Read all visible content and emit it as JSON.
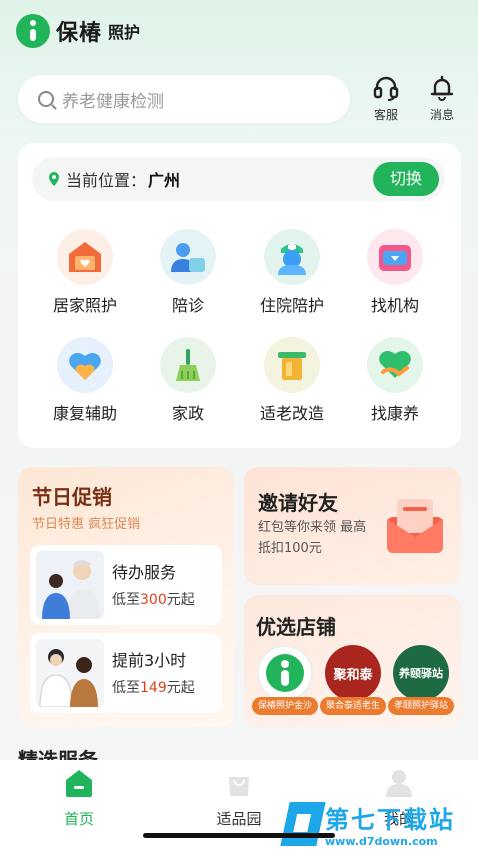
{
  "app": {
    "brand": "保椿",
    "brand_sub": "照护"
  },
  "search": {
    "placeholder": "养老健康检测"
  },
  "header_buttons": [
    {
      "label": "客服",
      "icon": "headset-icon"
    },
    {
      "label": "消息",
      "icon": "bell-icon"
    }
  ],
  "location": {
    "label": "当前位置：",
    "city": "广州",
    "switch_label": "切换"
  },
  "services": [
    {
      "label": "居家照护",
      "icon": "house-icon"
    },
    {
      "label": "陪诊",
      "icon": "escort-icon"
    },
    {
      "label": "住院陪护",
      "icon": "nurse-icon"
    },
    {
      "label": "找机构",
      "icon": "wallet-icon"
    },
    {
      "label": "康复辅助",
      "icon": "heart-icon"
    },
    {
      "label": "家政",
      "icon": "broom-icon"
    },
    {
      "label": "适老改造",
      "icon": "renovation-icon"
    },
    {
      "label": "找康养",
      "icon": "heart-hand-icon"
    }
  ],
  "promo": {
    "title": "节日促销",
    "subtitle": "节日特惠 疯狂促销",
    "items": [
      {
        "name": "待办服务",
        "price_prefix": "低至",
        "price": "300",
        "price_suffix": "元起"
      },
      {
        "name": "提前3小时",
        "price_prefix": "低至",
        "price": "149",
        "price_suffix": "元起"
      }
    ]
  },
  "invite": {
    "title": "邀请好友",
    "desc": "红包等你来领 最高抵扣100元"
  },
  "shops": {
    "title": "优选店铺",
    "items": [
      {
        "logo_text": "",
        "caption": "保椿照护金沙"
      },
      {
        "logo_text": "聚和泰",
        "caption": "聚合泰适老生"
      },
      {
        "logo_text": "养颐驿站",
        "caption": "孝颐照护驿站"
      }
    ]
  },
  "next_section": {
    "title": "精选服务"
  },
  "tabbar": [
    {
      "label": "首页",
      "active": true
    },
    {
      "label": "适品园",
      "active": false
    },
    {
      "label": "我的",
      "active": false
    }
  ],
  "watermark": {
    "title": "第七下载站",
    "url": "www.d7down.com"
  },
  "colors": {
    "primary": "#22b45a",
    "price": "#e0401c",
    "promo_title": "#7a2e12"
  }
}
